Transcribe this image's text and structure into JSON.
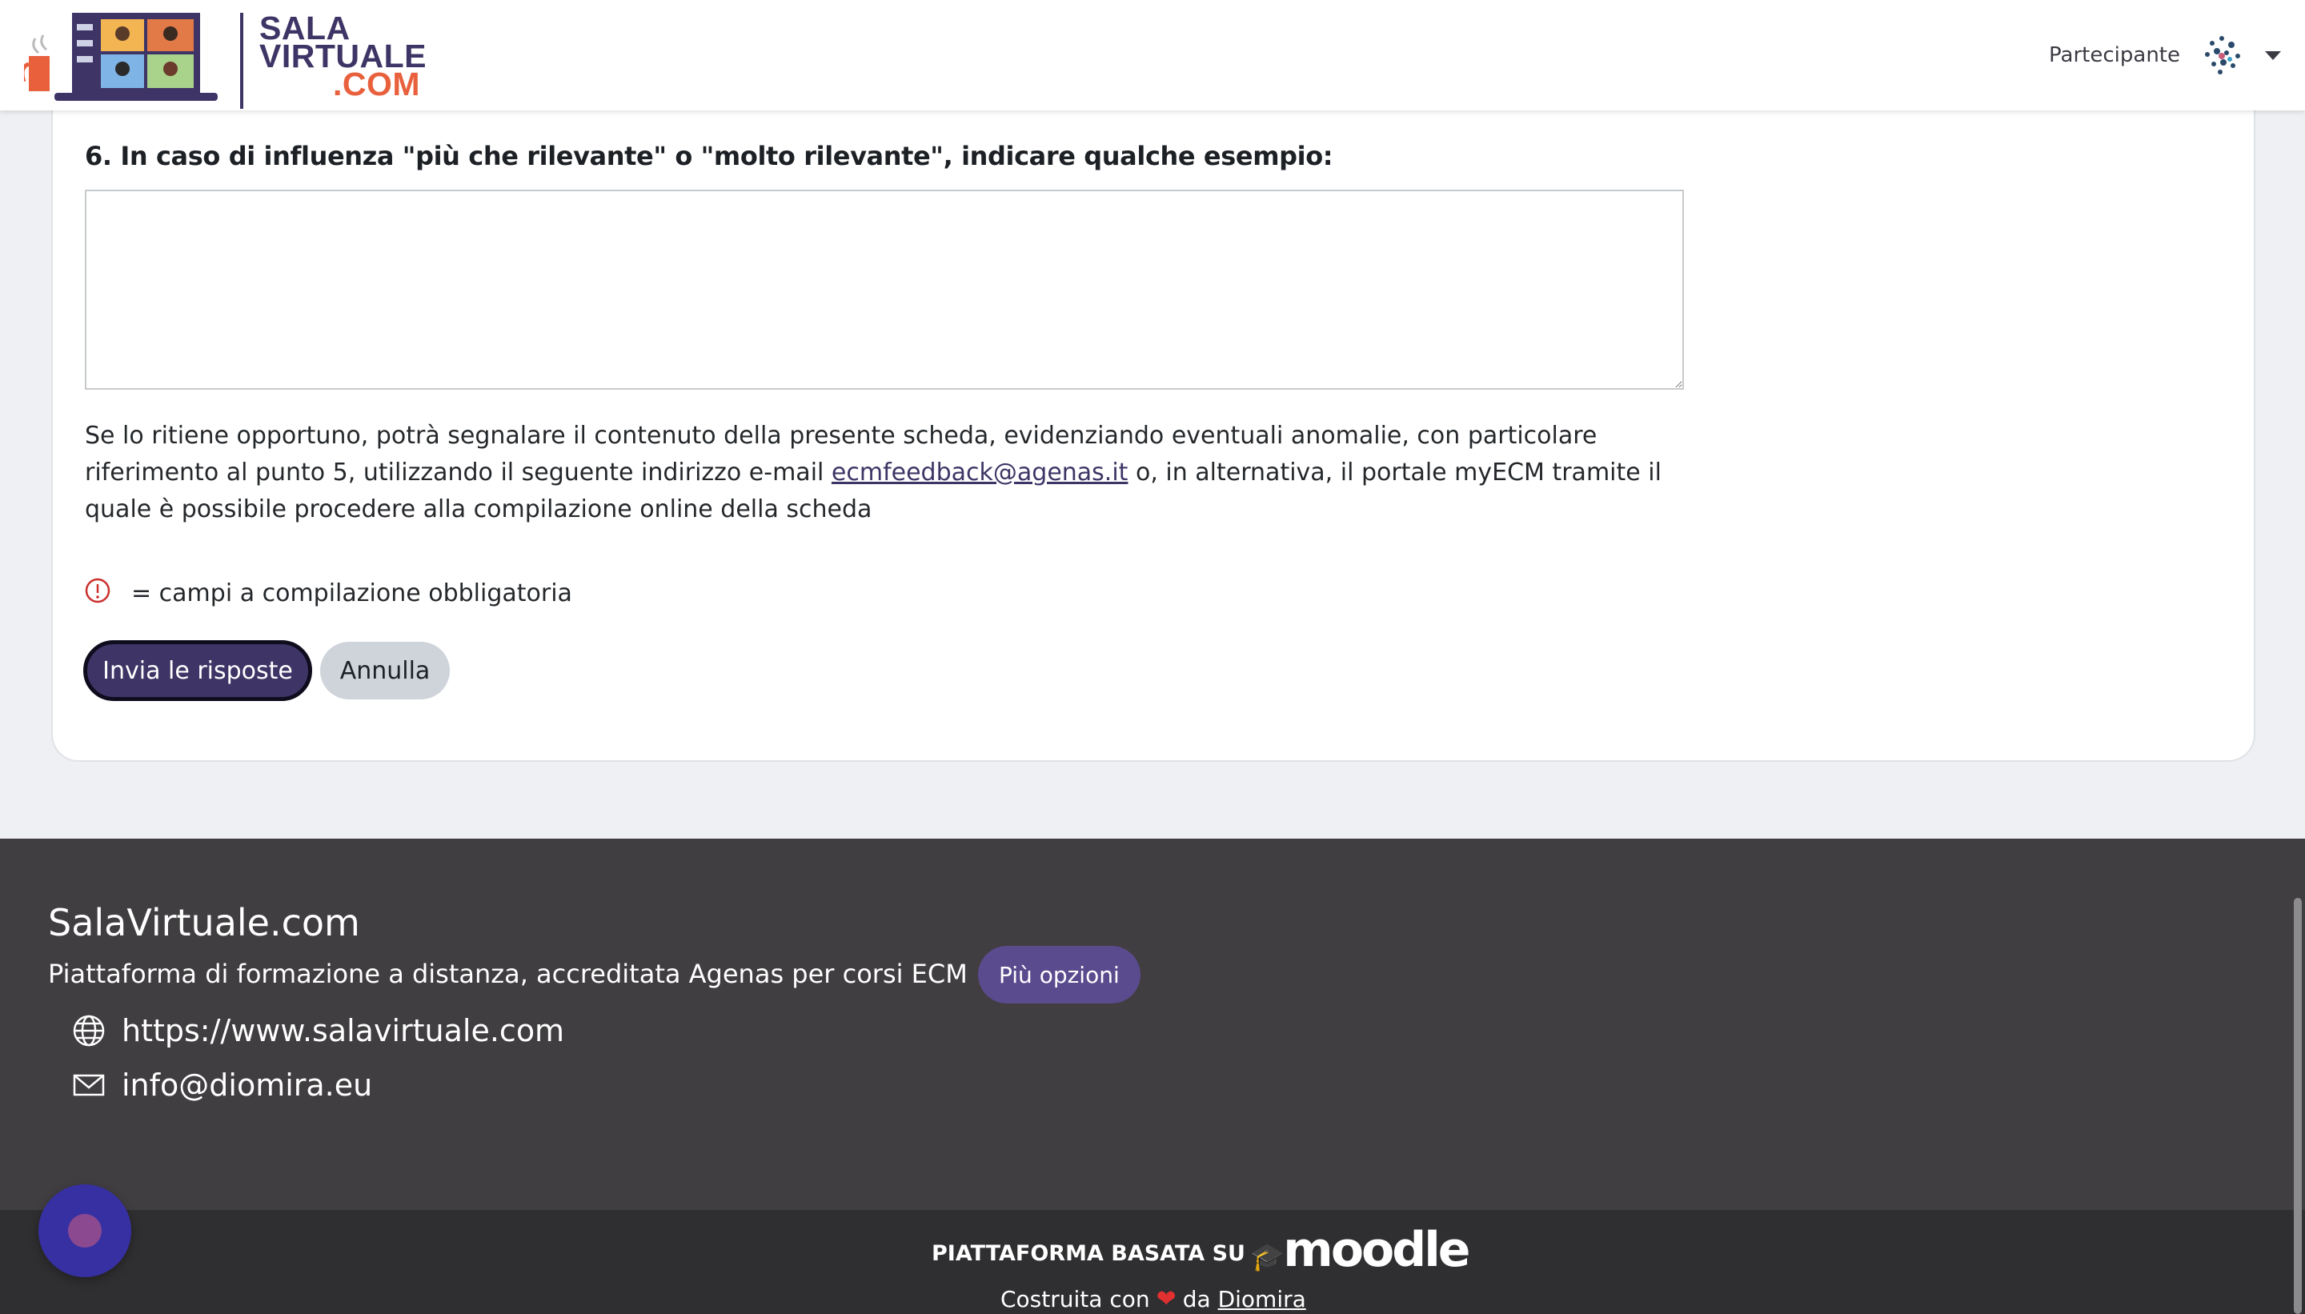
{
  "header": {
    "logo": {
      "line1": "SALA",
      "line2": "VIRTUALE",
      "line3": ".COM"
    },
    "user_role": "Partecipante",
    "colors": {
      "brand": "#3e3566",
      "accent": "#e8603c"
    }
  },
  "form": {
    "question": "6. In caso di influenza \"più che rilevante\" o \"molto rilevante\", indicare qualche esempio:",
    "answer_value": "",
    "notice_before": "Se lo ritiene opportuno, potrà segnalare il contenuto della presente scheda, evidenziando eventuali anomalie, con particolare riferimento al punto 5, utilizzando il seguente indirizzo e-mail ",
    "notice_link": "ecmfeedback@agenas.it",
    "notice_after": " o, in alternativa, il portale myECM tramite il quale è possibile procedere alla compilazione online della scheda",
    "required_note": "= campi a compilazione obbligatoria",
    "submit_label": "Invia le risposte",
    "cancel_label": "Annulla"
  },
  "footer": {
    "title": "SalaVirtuale.com",
    "description": "Piattaforma di formazione a distanza, accreditata Agenas per corsi ECM",
    "more_label": "Più opzioni",
    "website": "https://www.salavirtuale.com",
    "email": "info@diomira.eu",
    "powered_by": "PIATTAFORMA BASATA SU",
    "moodle": "moodle",
    "built_prefix": "Costruita con",
    "built_mid": "da",
    "built_link": "Diomira"
  }
}
